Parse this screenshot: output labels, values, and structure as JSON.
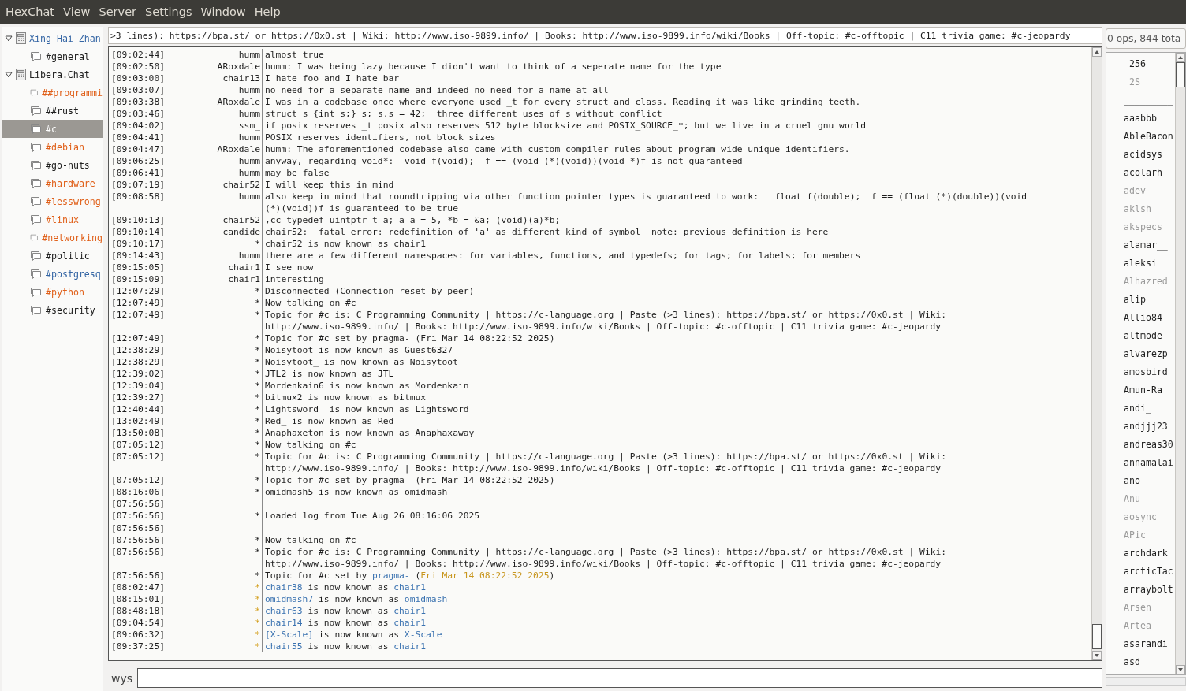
{
  "menu": [
    "HexChat",
    "View",
    "Server",
    "Settings",
    "Window",
    "Help"
  ],
  "tree": [
    {
      "label": "Xing-Hai-Zhan",
      "kind": "server",
      "expanded": true,
      "selected": false,
      "color": "#3465a4",
      "children": [
        {
          "label": "#general",
          "kind": "channel",
          "selected": false,
          "color": "#202020"
        }
      ]
    },
    {
      "label": "Libera.Chat",
      "kind": "server",
      "expanded": true,
      "selected": false,
      "color": "#202020",
      "children": [
        {
          "label": "##programmi",
          "kind": "channel",
          "selected": false,
          "color": "#e0601a"
        },
        {
          "label": "##rust",
          "kind": "channel",
          "selected": false,
          "color": "#202020"
        },
        {
          "label": "#c",
          "kind": "channel",
          "selected": true,
          "color": "#ffffff"
        },
        {
          "label": "#debian",
          "kind": "channel",
          "selected": false,
          "color": "#e0601a"
        },
        {
          "label": "#go-nuts",
          "kind": "channel",
          "selected": false,
          "color": "#202020"
        },
        {
          "label": "#hardware",
          "kind": "channel",
          "selected": false,
          "color": "#e0601a"
        },
        {
          "label": "#lesswrong",
          "kind": "channel",
          "selected": false,
          "color": "#e0601a"
        },
        {
          "label": "#linux",
          "kind": "channel",
          "selected": false,
          "color": "#e0601a"
        },
        {
          "label": "#networking",
          "kind": "channel",
          "selected": false,
          "color": "#e0601a"
        },
        {
          "label": "#politic",
          "kind": "channel",
          "selected": false,
          "color": "#202020"
        },
        {
          "label": "#postgresq",
          "kind": "channel",
          "selected": false,
          "color": "#3465a4"
        },
        {
          "label": "#python",
          "kind": "channel",
          "selected": false,
          "color": "#e0601a"
        },
        {
          "label": "#security",
          "kind": "channel",
          "selected": false,
          "color": "#202020"
        }
      ]
    }
  ],
  "topic": ">3 lines): https://bpa.st/ or https://0x0.st | Wiki: http://www.iso-9899.info/ | Books: http://www.iso-9899.info/wiki/Books | Off-topic: #c-offtopic | C11 trivia game: #c-jeopardy",
  "chat": [
    {
      "kind": "line",
      "time": "[09:02:44]",
      "nick": "humm",
      "text": "almost true"
    },
    {
      "kind": "line",
      "time": "[09:02:50]",
      "nick": "ARoxdale",
      "text": "humm: I was being lazy because I didn't want to think of a seperate name for the type"
    },
    {
      "kind": "line",
      "time": "[09:03:00]",
      "nick": "chair13",
      "text": "I hate foo and I hate bar"
    },
    {
      "kind": "line",
      "time": "[09:03:07]",
      "nick": "humm",
      "text": "no need for a separate name and indeed no need for a name at all"
    },
    {
      "kind": "line",
      "time": "[09:03:38]",
      "nick": "ARoxdale",
      "text": "I was in a codebase once where everyone used _t for every struct and class. Reading it was like grinding teeth."
    },
    {
      "kind": "line",
      "time": "[09:03:46]",
      "nick": "humm",
      "text": "struct s {int s;} s; s.s = 42;  three different uses of s without conflict"
    },
    {
      "kind": "line",
      "time": "[09:04:02]",
      "nick": "ssm_",
      "text": "if posix reserves _t posix also reserves 512 byte blocksize and POSIX_SOURCE_*; but we live in a cruel gnu world"
    },
    {
      "kind": "line",
      "time": "[09:04:41]",
      "nick": "humm",
      "text": "POSIX reserves identifiers, not block sizes"
    },
    {
      "kind": "line",
      "time": "[09:04:47]",
      "nick": "ARoxdale",
      "text": "humm: The aforementioned codebase also came with custom compiler rules about program-wide unique identifiers."
    },
    {
      "kind": "line",
      "time": "[09:06:25]",
      "nick": "humm",
      "text": "anyway, regarding void*:  void f(void);  f == (void (*)(void))(void *)f is not guaranteed"
    },
    {
      "kind": "line",
      "time": "[09:06:41]",
      "nick": "humm",
      "text": "may be false"
    },
    {
      "kind": "line",
      "time": "[09:07:19]",
      "nick": "chair52",
      "text": "I will keep this in mind"
    },
    {
      "kind": "line",
      "time": "[09:08:58]",
      "nick": "humm",
      "text": "also keep in mind that roundtripping via other function pointer types is guaranteed to work:   float f(double);  f == (float (*)(double))(void (*)(void))f is guaranteed to be true"
    },
    {
      "kind": "line",
      "time": "[09:10:13]",
      "nick": "chair52",
      "text": ",cc typedef uintptr_t a; a a = 5, *b = &a; (void)(a)*b;"
    },
    {
      "kind": "line",
      "time": "[09:10:14]",
      "nick": "candide",
      "text": "chair52:  fatal error: redefinition of 'a' as different kind of symbol  note: previous definition is here"
    },
    {
      "kind": "line",
      "time": "[09:10:17]",
      "nick": "*",
      "text": "chair52 is now known as chair1"
    },
    {
      "kind": "line",
      "time": "[09:14:43]",
      "nick": "humm",
      "text": "there are a few different namespaces: for variables, functions, and typedefs; for tags; for labels; for members"
    },
    {
      "kind": "line",
      "time": "[09:15:05]",
      "nick": "chair1",
      "text": "I see now"
    },
    {
      "kind": "line",
      "time": "[09:15:09]",
      "nick": "chair1",
      "text": "interesting"
    },
    {
      "kind": "line",
      "time": "[12:07:29]",
      "nick": "*",
      "text": "Disconnected (Connection reset by peer)"
    },
    {
      "kind": "line",
      "time": "[12:07:49]",
      "nick": "*",
      "text": "Now talking on #c"
    },
    {
      "kind": "line",
      "time": "[12:07:49]",
      "nick": "*",
      "text": "Topic for #c is: C Programming Community | https://c-language.org | Paste (>3 lines): https://bpa.st/ or https://0x0.st | Wiki: http://www.iso-9899.info/ | Books: http://www.iso-9899.info/wiki/Books | Off-topic: #c-offtopic | C11 trivia game: #c-jeopardy"
    },
    {
      "kind": "line",
      "time": "[12:07:49]",
      "nick": "*",
      "text": "Topic for #c set by pragma- (Fri Mar 14 08:22:52 2025)"
    },
    {
      "kind": "line",
      "time": "[12:38:29]",
      "nick": "*",
      "text": "Noisytoot is now known as Guest6327"
    },
    {
      "kind": "line",
      "time": "[12:38:29]",
      "nick": "*",
      "text": "Noisytoot_ is now known as Noisytoot"
    },
    {
      "kind": "line",
      "time": "[12:39:02]",
      "nick": "*",
      "text": "JTL2 is now known as JTL"
    },
    {
      "kind": "line",
      "time": "[12:39:04]",
      "nick": "*",
      "text": "Mordenkain6 is now known as Mordenkain"
    },
    {
      "kind": "line",
      "time": "[12:39:27]",
      "nick": "*",
      "text": "bitmux2 is now known as bitmux"
    },
    {
      "kind": "line",
      "time": "[12:40:44]",
      "nick": "*",
      "text": "Lightsword_ is now known as Lightsword"
    },
    {
      "kind": "line",
      "time": "[13:02:49]",
      "nick": "*",
      "text": "Red_ is now known as Red"
    },
    {
      "kind": "line",
      "time": "[13:50:08]",
      "nick": "*",
      "text": "Anaphaxeton is now known as Anaphaxaway"
    },
    {
      "kind": "line",
      "time": "[07:05:12]",
      "nick": "*",
      "text": "Now talking on #c"
    },
    {
      "kind": "line",
      "time": "[07:05:12]",
      "nick": "*",
      "text": "Topic for #c is: C Programming Community | https://c-language.org | Paste (>3 lines): https://bpa.st/ or https://0x0.st | Wiki: http://www.iso-9899.info/ | Books: http://www.iso-9899.info/wiki/Books | Off-topic: #c-offtopic | C11 trivia game: #c-jeopardy"
    },
    {
      "kind": "line",
      "time": "[07:05:12]",
      "nick": "*",
      "text": "Topic for #c set by pragma- (Fri Mar 14 08:22:52 2025)"
    },
    {
      "kind": "line",
      "time": "[08:16:06]",
      "nick": "*",
      "text": "omidmash5 is now known as omidmash"
    },
    {
      "kind": "line",
      "time": "[07:56:56]"
    },
    {
      "kind": "line",
      "time": "[07:56:56]",
      "nick": "*",
      "text": "Loaded log from Tue Aug 26 08:16:06 2025"
    },
    {
      "kind": "marker"
    },
    {
      "kind": "line",
      "time": "[07:56:56]"
    },
    {
      "kind": "line",
      "time": "[07:56:56]",
      "nick": "*",
      "text": "Now talking on #c"
    },
    {
      "kind": "line",
      "time": "[07:56:56]",
      "nick": "*",
      "text": "Topic for #c is: C Programming Community | https://c-language.org | Paste (>3 lines): https://bpa.st/ or https://0x0.st | Wiki: http://www.iso-9899.info/ | Books: http://www.iso-9899.info/wiki/Books | Off-topic: #c-offtopic | C11 trivia game: #c-jeopardy"
    },
    {
      "kind": "line",
      "time": "[07:56:56]",
      "nick": "*",
      "parts": [
        {
          "kind": "text",
          "text": "Topic for #c set by "
        },
        {
          "kind": "nick",
          "text": "pragma-"
        },
        {
          "kind": "text",
          "text": " ("
        },
        {
          "kind": "date",
          "text": "Fri Mar 14 08:22:52 2025"
        },
        {
          "kind": "text",
          "text": ")"
        }
      ]
    },
    {
      "kind": "line",
      "time": "[08:02:47]",
      "nick": "*",
      "highlight": true,
      "parts": [
        {
          "kind": "nick",
          "text": "chair38"
        },
        {
          "kind": "text",
          "text": " is now known as "
        },
        {
          "kind": "nick",
          "text": "chair1"
        }
      ]
    },
    {
      "kind": "line",
      "time": "[08:15:01]",
      "nick": "*",
      "highlight": true,
      "parts": [
        {
          "kind": "nick",
          "text": "omidmash7"
        },
        {
          "kind": "text",
          "text": " is now known as "
        },
        {
          "kind": "nick",
          "text": "omidmash"
        }
      ]
    },
    {
      "kind": "line",
      "time": "[08:48:18]",
      "nick": "*",
      "highlight": true,
      "parts": [
        {
          "kind": "nick",
          "text": "chair63"
        },
        {
          "kind": "text",
          "text": " is now known as "
        },
        {
          "kind": "nick",
          "text": "chair1"
        }
      ]
    },
    {
      "kind": "line",
      "time": "[09:04:54]",
      "nick": "*",
      "highlight": true,
      "parts": [
        {
          "kind": "nick",
          "text": "chair14"
        },
        {
          "kind": "text",
          "text": " is now known as "
        },
        {
          "kind": "nick",
          "text": "chair1"
        }
      ]
    },
    {
      "kind": "line",
      "time": "[09:06:32]",
      "nick": "*",
      "highlight": true,
      "parts": [
        {
          "kind": "nick",
          "text": "[X-Scale]"
        },
        {
          "kind": "text",
          "text": " is now known as "
        },
        {
          "kind": "nick",
          "text": "X-Scale"
        }
      ]
    },
    {
      "kind": "line",
      "time": "[09:37:25]",
      "nick": "*",
      "highlight": true,
      "parts": [
        {
          "kind": "nick",
          "text": "chair55"
        },
        {
          "kind": "text",
          "text": " is now known as "
        },
        {
          "kind": "nick",
          "text": "chair1"
        }
      ]
    }
  ],
  "input": {
    "nick": "wys"
  },
  "user_count": "0 ops, 844 tota",
  "users": [
    {
      "name": "_256",
      "away": false
    },
    {
      "name": "_2S_",
      "away": true
    },
    {
      "name": "_________",
      "away": false
    },
    {
      "name": "aaabbb",
      "away": false
    },
    {
      "name": "AbleBacon",
      "away": false
    },
    {
      "name": "acidsys",
      "away": false
    },
    {
      "name": "acolarh",
      "away": false
    },
    {
      "name": "adev",
      "away": true
    },
    {
      "name": "aklsh",
      "away": true
    },
    {
      "name": "akspecs",
      "away": true
    },
    {
      "name": "alamar__",
      "away": false
    },
    {
      "name": "aleksi",
      "away": false
    },
    {
      "name": "Alhazred",
      "away": true
    },
    {
      "name": "alip",
      "away": false
    },
    {
      "name": "Allio84",
      "away": false
    },
    {
      "name": "altmode",
      "away": false
    },
    {
      "name": "alvarezp",
      "away": false
    },
    {
      "name": "amosbird",
      "away": false
    },
    {
      "name": "Amun-Ra",
      "away": false
    },
    {
      "name": "andi_",
      "away": false
    },
    {
      "name": "andjjj23",
      "away": false
    },
    {
      "name": "andreas30",
      "away": false
    },
    {
      "name": "annamalai",
      "away": false
    },
    {
      "name": "ano",
      "away": false
    },
    {
      "name": "Anu",
      "away": true
    },
    {
      "name": "aosync",
      "away": true
    },
    {
      "name": "APic",
      "away": true
    },
    {
      "name": "archdark",
      "away": false
    },
    {
      "name": "arcticTac",
      "away": false
    },
    {
      "name": "arraybolt",
      "away": false
    },
    {
      "name": "Arsen",
      "away": true
    },
    {
      "name": "Artea",
      "away": true
    },
    {
      "name": "asarandi",
      "away": false
    },
    {
      "name": "asd",
      "away": false
    }
  ]
}
